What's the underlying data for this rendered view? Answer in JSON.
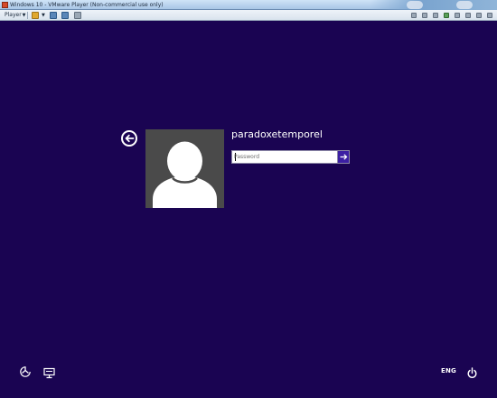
{
  "window": {
    "title": "Windows 10 - VMware Player (Non-commercial use only)"
  },
  "toolbar": {
    "player_label": "Player"
  },
  "login": {
    "username": "paradoxetemporel",
    "password_placeholder": "Password"
  },
  "bottom": {
    "language": "ENG"
  },
  "icons": {
    "back": "back-arrow-icon",
    "submit": "submit-arrow-icon",
    "ease_of_access": "ease-of-access-icon",
    "display": "display-icon",
    "power": "power-icon"
  },
  "colors": {
    "background": "#1a0452",
    "submit_button": "#3c1fa3",
    "avatar_bg": "#4a4a4a"
  }
}
